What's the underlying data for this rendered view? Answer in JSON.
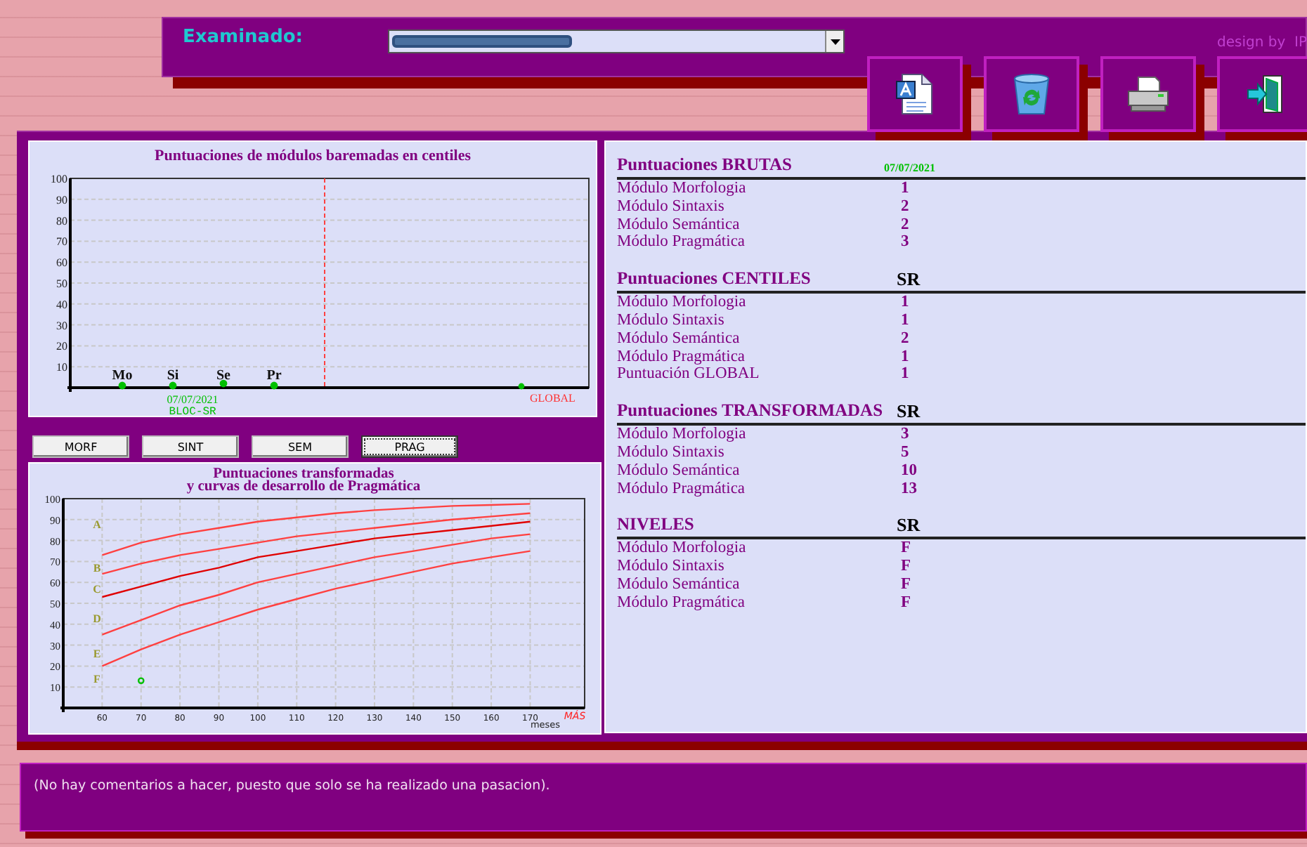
{
  "header": {
    "label": "Examinado:",
    "credit": "design by  IP",
    "toolbar": [
      {
        "kind": "document"
      },
      {
        "kind": "recycle"
      },
      {
        "kind": "print"
      },
      {
        "kind": "exit"
      }
    ]
  },
  "module_chart": {
    "chart_data": {
      "type": "scatter",
      "title": "Puntuaciones de módulos baremadas en centiles",
      "grid": true,
      "categories": [
        "Mo",
        "Si",
        "Se",
        "Pr"
      ],
      "series": [
        {
          "name": "07/07/2021",
          "color": "#00c000",
          "values": [
            1,
            1,
            2,
            1
          ]
        }
      ],
      "ylim": [
        0,
        100
      ],
      "yticks": [
        10,
        20,
        30,
        40,
        50,
        60,
        70,
        80,
        90,
        100
      ]
    },
    "session_label": "BLOC-SR",
    "global_label": "GLOBAL"
  },
  "module_tabs": [
    {
      "label": "MORF",
      "selected": false
    },
    {
      "label": "SINT",
      "selected": false
    },
    {
      "label": "SEM",
      "selected": false
    },
    {
      "label": "PRAG",
      "selected": true
    }
  ],
  "curve_chart": {
    "chart_data": {
      "type": "line",
      "grid": true,
      "xlim": [
        50,
        184
      ],
      "title": "Puntuaciones transformadas\ny curvas de desarrollo de Pragmática",
      "xlabel": "meses",
      "x": [
        60,
        70,
        80,
        90,
        100,
        110,
        120,
        130,
        140,
        150,
        160,
        170
      ],
      "xticks": [
        60,
        70,
        80,
        90,
        100,
        110,
        120,
        130,
        140,
        150,
        160,
        170
      ],
      "ylim": [
        0,
        100
      ],
      "yticks": [
        10,
        20,
        30,
        40,
        50,
        60,
        70,
        80,
        90,
        100
      ],
      "series": [
        {
          "color": "#ff4040",
          "values": [
            73,
            79,
            83,
            86,
            89,
            91,
            93,
            94.5,
            95.5,
            96.5,
            97,
            97.5
          ]
        },
        {
          "color": "#ff4040",
          "values": [
            64,
            69,
            73,
            76,
            79,
            82,
            84,
            86,
            88,
            90,
            91.5,
            93
          ]
        },
        {
          "color": "#e00000",
          "values": [
            53,
            58,
            63,
            67,
            72,
            75,
            78,
            81,
            83,
            85,
            87,
            89
          ]
        },
        {
          "color": "#ff4040",
          "values": [
            35,
            42,
            49,
            54,
            60,
            64,
            68,
            72,
            75,
            78,
            81,
            83
          ]
        },
        {
          "color": "#ff4040",
          "values": [
            20,
            28,
            35,
            41,
            47,
            52,
            57,
            61,
            65,
            69,
            72,
            75
          ]
        },
        {
          "color": "#00c000",
          "marker": true,
          "values": [
            null,
            13,
            null,
            null,
            null,
            null,
            null,
            null,
            null,
            null,
            null,
            null
          ]
        }
      ]
    },
    "band_labels": [
      "A",
      "B",
      "C",
      "D",
      "E",
      "F"
    ],
    "extra_label": "MÁS"
  },
  "score_sections": [
    {
      "title": "Puntuaciones BRUTAS",
      "tag": {
        "text": "07/07/2021",
        "kind": "date"
      },
      "rows": [
        {
          "label": "Módulo Morfologia",
          "value": "1"
        },
        {
          "label": "Módulo Sintaxis",
          "value": "2"
        },
        {
          "label": "Módulo Semántica",
          "value": "2"
        },
        {
          "label": "Módulo Pragmática",
          "value": "3"
        }
      ]
    },
    {
      "title": "Puntuaciones CENTILES",
      "tag": {
        "text": "SR",
        "kind": "session"
      },
      "rows": [
        {
          "label": "Módulo Morfologia",
          "value": "1"
        },
        {
          "label": "Módulo Sintaxis",
          "value": "1"
        },
        {
          "label": "Módulo Semántica",
          "value": "2"
        },
        {
          "label": "Módulo Pragmática",
          "value": "1"
        },
        {
          "label": "Puntuación GLOBAL",
          "value": "1"
        }
      ]
    },
    {
      "title": "Puntuaciones TRANSFORMADAS",
      "tag": {
        "text": "SR",
        "kind": "session"
      },
      "rows": [
        {
          "label": "Módulo Morfologia",
          "value": "3"
        },
        {
          "label": "Módulo Sintaxis",
          "value": "5"
        },
        {
          "label": "Módulo Semántica",
          "value": "10"
        },
        {
          "label": "Módulo Pragmática",
          "value": "13"
        }
      ]
    },
    {
      "title": "NIVELES",
      "tag": {
        "text": "SR",
        "kind": "session"
      },
      "rows": [
        {
          "label": "Módulo Morfologia",
          "value": "F"
        },
        {
          "label": "Módulo Sintaxis",
          "value": "F"
        },
        {
          "label": "Módulo Semántica",
          "value": "F"
        },
        {
          "label": "Módulo Pragmática",
          "value": "F"
        }
      ]
    }
  ],
  "comment": "(No hay comentarios a hacer, puesto que solo se ha realizado una pasacion)."
}
